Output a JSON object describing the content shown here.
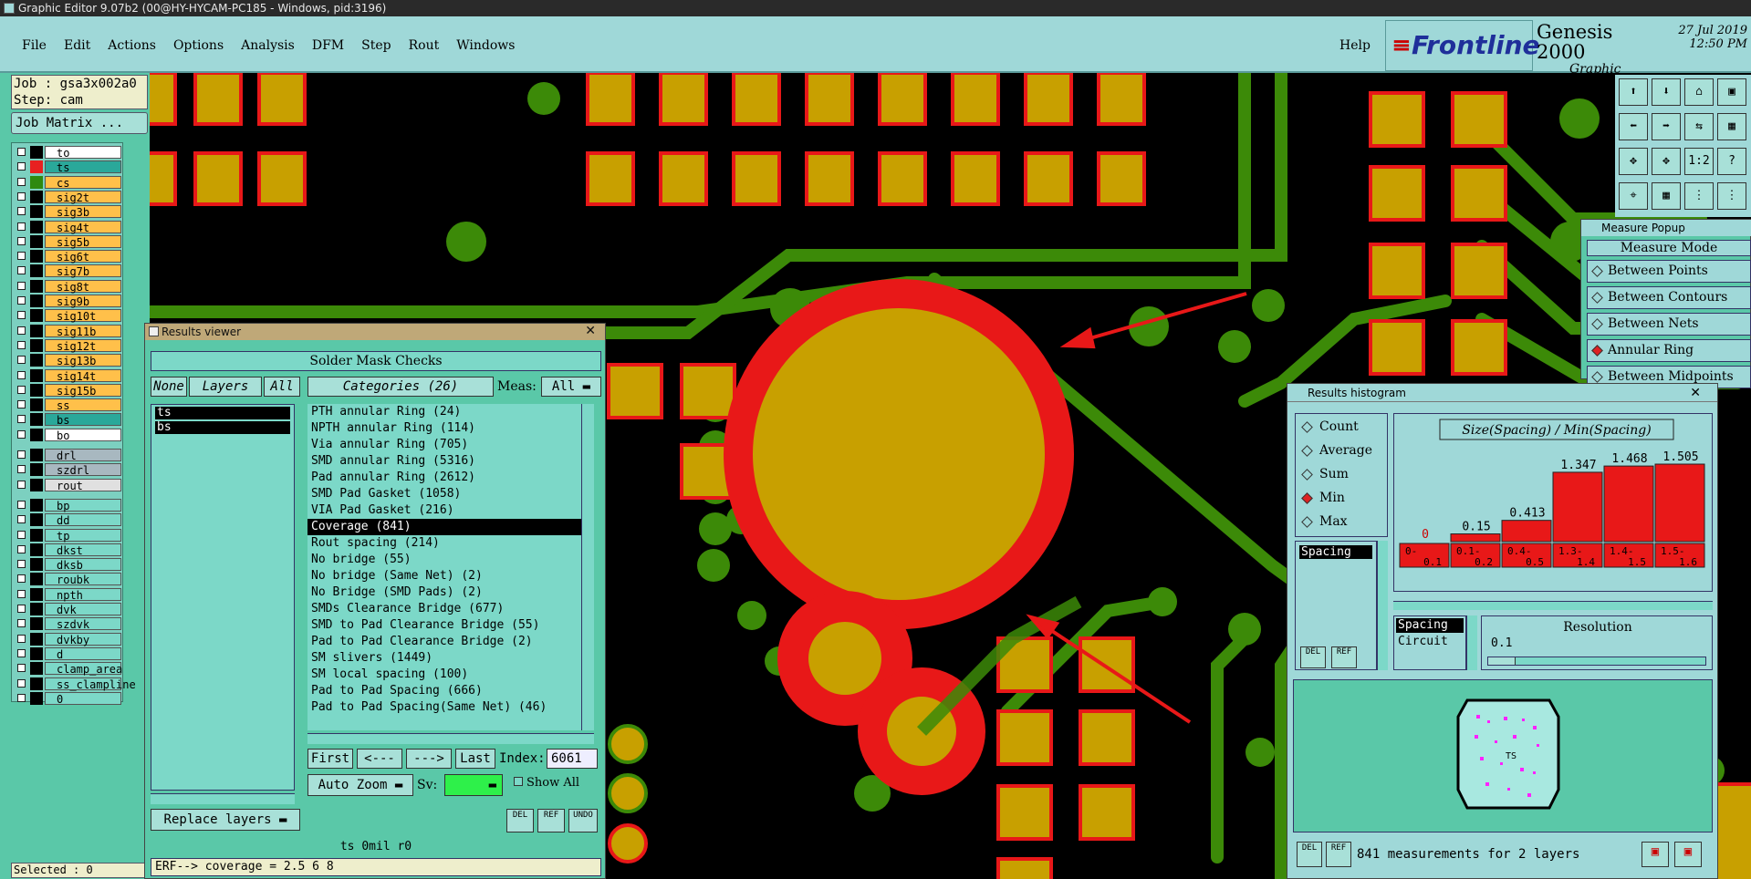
{
  "window_title": "Graphic Editor 9.07b2 (00@HY-HYCAM-PC185 - Windows, pid:3196)",
  "menu": [
    "File",
    "Edit",
    "Actions",
    "Options",
    "Analysis",
    "DFM",
    "Step",
    "Rout",
    "Windows"
  ],
  "help_label": "Help",
  "logo": {
    "brand": "Frontline",
    "product": "Genesis 2000",
    "subtitle": "Graphic Editor",
    "date": "27 Jul 2019",
    "time": "12:50 PM"
  },
  "job": {
    "job_label": "Job : gsa3x002a0",
    "step_label": "Step: cam",
    "matrix_button": "Job Matrix ..."
  },
  "layers": [
    {
      "name": "to",
      "color": "#ffffff",
      "swatch": "#000000"
    },
    {
      "name": "ts",
      "color": "#2aa89a",
      "swatch": "#e82020"
    },
    {
      "name": "cs",
      "color": "#ffc04a",
      "swatch": "#2e8a10"
    },
    {
      "name": "sig2t",
      "color": "#ffc04a",
      "swatch": "#000000"
    },
    {
      "name": "sig3b",
      "color": "#ffc04a",
      "swatch": "#000000"
    },
    {
      "name": "sig4t",
      "color": "#ffc04a",
      "swatch": "#000000"
    },
    {
      "name": "sig5b",
      "color": "#ffc04a",
      "swatch": "#000000"
    },
    {
      "name": "sig6t",
      "color": "#ffc04a",
      "swatch": "#000000"
    },
    {
      "name": "sig7b",
      "color": "#ffc04a",
      "swatch": "#000000"
    },
    {
      "name": "sig8t",
      "color": "#ffc04a",
      "swatch": "#000000"
    },
    {
      "name": "sig9b",
      "color": "#ffc04a",
      "swatch": "#000000"
    },
    {
      "name": "sig10t",
      "color": "#ffc04a",
      "swatch": "#000000"
    },
    {
      "name": "sig11b",
      "color": "#ffc04a",
      "swatch": "#000000"
    },
    {
      "name": "sig12t",
      "color": "#ffc04a",
      "swatch": "#000000"
    },
    {
      "name": "sig13b",
      "color": "#ffc04a",
      "swatch": "#000000"
    },
    {
      "name": "sig14t",
      "color": "#ffc04a",
      "swatch": "#000000"
    },
    {
      "name": "sig15b",
      "color": "#ffc04a",
      "swatch": "#000000"
    },
    {
      "name": "ss",
      "color": "#ffc04a",
      "swatch": "#000000"
    },
    {
      "name": "bs",
      "color": "#2aa89a",
      "swatch": "#000000"
    },
    {
      "name": "bo",
      "color": "#ffffff",
      "swatch": "#000000"
    },
    {
      "name": "drl",
      "color": "#a8b8c0",
      "swatch": "#000000"
    },
    {
      "name": "szdrl",
      "color": "#a8b8c0",
      "swatch": "#000000"
    },
    {
      "name": "rout",
      "color": "#e0e0e0",
      "swatch": "#000000"
    },
    {
      "name": "bp",
      "color": "#7cd8c8",
      "swatch": "#000000"
    },
    {
      "name": "dd",
      "color": "#7cd8c8",
      "swatch": "#000000"
    },
    {
      "name": "tp",
      "color": "#7cd8c8",
      "swatch": "#000000"
    },
    {
      "name": "dkst",
      "color": "#7cd8c8",
      "swatch": "#000000"
    },
    {
      "name": "dksb",
      "color": "#7cd8c8",
      "swatch": "#000000"
    },
    {
      "name": "roubk",
      "color": "#7cd8c8",
      "swatch": "#000000"
    },
    {
      "name": "npth",
      "color": "#7cd8c8",
      "swatch": "#000000"
    },
    {
      "name": "dvk",
      "color": "#7cd8c8",
      "swatch": "#000000"
    },
    {
      "name": "szdvk",
      "color": "#7cd8c8",
      "swatch": "#000000"
    },
    {
      "name": "dvkby",
      "color": "#7cd8c8",
      "swatch": "#000000"
    },
    {
      "name": "d",
      "color": "#7cd8c8",
      "swatch": "#000000"
    },
    {
      "name": "clamp_area",
      "color": "#7cd8c8",
      "swatch": "#000000"
    },
    {
      "name": "ss_clampline",
      "color": "#7cd8c8",
      "swatch": "#000000"
    },
    {
      "name": "0",
      "color": "#7cd8c8",
      "swatch": "#000000"
    }
  ],
  "selected_status": "Selected : 0",
  "results_viewer": {
    "title": "Results viewer",
    "heading": "Solder Mask Checks",
    "none_btn": "None",
    "layers_btn": "Layers",
    "all_btn": "All",
    "categories_btn": "Categories (26)",
    "meas_label": "Meas:",
    "meas_value": "All",
    "layer_items": [
      "ts",
      "bs"
    ],
    "categories": [
      "PTH annular Ring (24)",
      "NPTH annular Ring (114)",
      "Via annular Ring (705)",
      "SMD annular Ring (5316)",
      "Pad annular Ring (2612)",
      "SMD Pad Gasket (1058)",
      "VIA Pad Gasket (216)",
      "Coverage (841)",
      "Rout spacing (214)",
      "No bridge (55)",
      "No bridge (Same Net) (2)",
      "No Bridge (SMD Pads) (2)",
      "SMDs Clearance Bridge (677)",
      "SMD to Pad Clearance Bridge (55)",
      "Pad to Pad Clearance Bridge (2)",
      "SM slivers (1449)",
      "SM local spacing (100)",
      "Pad to Pad Spacing (666)",
      "Pad to Pad Spacing(Same Net) (46)"
    ],
    "selected_category_index": 7,
    "first_btn": "First",
    "prev_btn": "<---",
    "next_btn": "--->",
    "last_btn": "Last",
    "index_label": "Index:",
    "index_value": "6061",
    "auto_zoom": "Auto Zoom",
    "sv_label": "Sv:",
    "show_all": "Show All",
    "replace_layers": "Replace layers",
    "del_btn": "DEL",
    "ref_btn": "REF",
    "undo_btn": "UNDO",
    "status_line": "ts 0mil  r0",
    "erf_line": "ERF--> coverage = 2.5 6 8"
  },
  "measure_popup": {
    "title": "Measure Popup",
    "heading": "Measure Mode",
    "options": [
      "Between Points",
      "Between Contours",
      "Between Nets",
      "Annular Ring",
      "Between Midpoints"
    ],
    "selected_index": 3
  },
  "toolbar_icons": [
    "fit-icon",
    "zoom-in-icon",
    "home-icon",
    "redraw-icon",
    "pan-left-icon",
    "pan-right-icon",
    "snap-icon",
    "grid-icon",
    "fit-all-icon",
    "zoom-area-icon",
    "scale-icon",
    "query-icon",
    "measure-icon",
    "layout-icon",
    "net-icon",
    "net2-icon"
  ],
  "toolbar_scale_label": "1:2",
  "toolbar_query_label": "?",
  "histogram": {
    "title": "Results histogram",
    "modes": [
      "Count",
      "Average",
      "Sum",
      "Min",
      "Max"
    ],
    "selected_mode_index": 3,
    "list_items": [
      "Spacing"
    ],
    "chart_title": "Size(Spacing) / Min(Spacing)",
    "bins": [
      "0-0.1",
      "0.1-0.2",
      "0.4-0.5",
      "1.3-1.4",
      "1.4-1.5",
      "1.5-1.6"
    ],
    "values": [
      0,
      0.15,
      0.413,
      1.347,
      1.468,
      1.505
    ],
    "value_labels": [
      "0",
      "0.15",
      "0.413",
      "1.347",
      "1.468",
      "1.505"
    ],
    "ymax": 1.7,
    "attr_items": [
      "Spacing",
      "Circuit"
    ],
    "resolution_label": "Resolution",
    "resolution_value": "0.1",
    "del_btn": "DEL",
    "ref_btn": "REF",
    "board_label": "TS",
    "summary": "841 measurements for 2 layers"
  },
  "colors": {
    "pad_fill": "#c8a000",
    "pad_edge": "#e81818",
    "trace": "#3c8a08",
    "panel": "#5ac8a8"
  }
}
